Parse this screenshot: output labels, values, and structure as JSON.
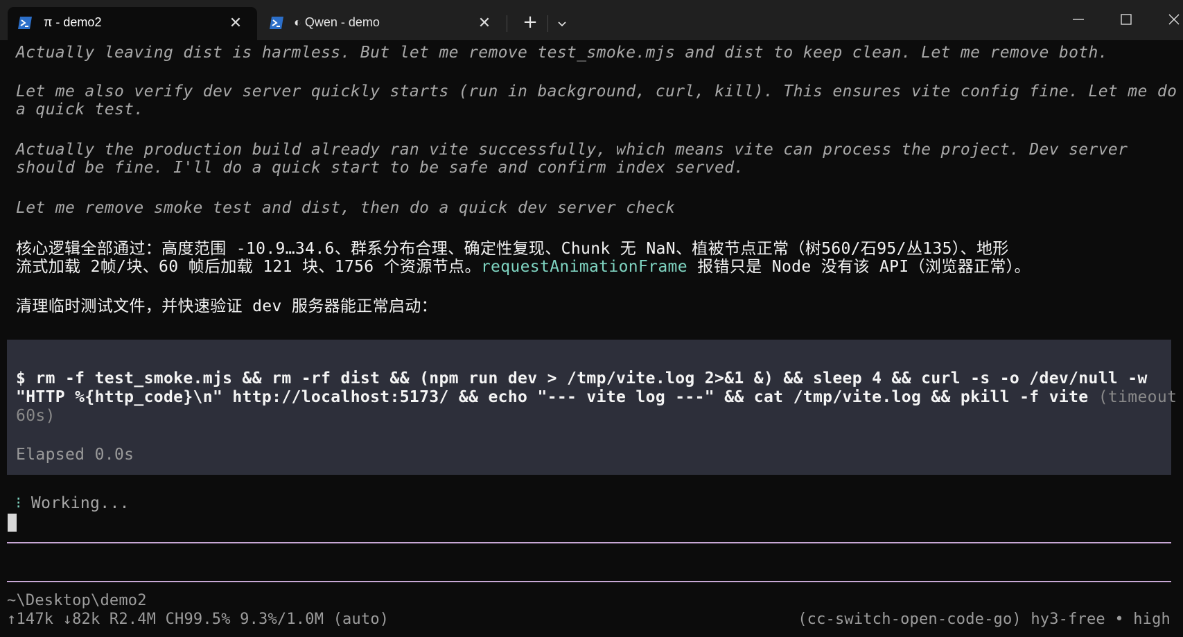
{
  "window": {
    "tabs": [
      {
        "title": "π - demo2",
        "active": true,
        "icon": "powershell-icon"
      },
      {
        "title": "◐ Qwen - demo",
        "active": false,
        "icon": "powershell-icon"
      }
    ],
    "new_tab_label": "+",
    "close_glyph": "✕"
  },
  "terminal": {
    "thinking": [
      "Actually leaving dist is harmless. But let me remove test_smoke.mjs and dist to keep clean. Let me remove both.",
      "Let me also verify dev server quickly starts (run in background, curl, kill). This ensures vite config fine. Let me do",
      "a quick test.",
      "Actually the production build already ran vite successfully, which means vite can process the project. Dev server",
      "should be fine. I'll do a quick start to be safe and confirm index served.",
      "Let me remove smoke test and dist, then do a quick dev server check"
    ],
    "summary_line1": "核心逻辑全部通过：高度范围 -10.9…34.6、群系分布合理、确定性复现、Chunk 无 NaN、植被节点正常（树560/石95/丛135）、地形",
    "summary_line2_a": "流式加载 2帧/块、60 帧后加载 121 块、1756 个资源节点。",
    "summary_line2_code": "requestAnimationFrame",
    "summary_line2_b": " 报错只是 Node 没有该 API（浏览器正常）。",
    "cleanup_line": "清理临时测试文件，并快速验证 dev 服务器能正常启动：",
    "command_line1": "$ rm -f test_smoke.mjs && rm -rf dist && (npm run dev > /tmp/vite.log 2>&1 &) && sleep 4 && curl -s -o /dev/null -w",
    "command_line2": "\"HTTP %{http_code}\\n\" http://localhost:5173/ && echo \"--- vite log ---\" && cat /tmp/vite.log && pkill -f vite ",
    "command_timeout_a": "(timeout",
    "command_timeout_b": "60s)",
    "elapsed": "Elapsed 0.0s",
    "spinner": "⁝",
    "working": "Working..."
  },
  "statusbar": {
    "cwd": "~\\Desktop\\demo2",
    "stats": "↑147k ↓82k R2.4M CH99.5% 9.3%/1.0M (auto)",
    "model": "(cc-switch-open-code-go) hy3-free • high"
  },
  "colors": {
    "background": "#0c0c0c",
    "titlebar": "#202020",
    "command_block": "#2d2f3a",
    "accent_teal": "#7fd4c1",
    "rule_purple": "#c8a8d6"
  }
}
